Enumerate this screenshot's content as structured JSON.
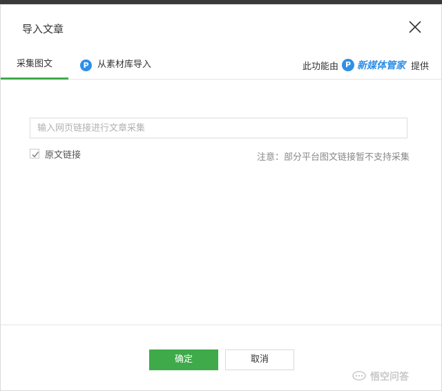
{
  "dialog": {
    "title": "导入文章"
  },
  "tabs": [
    {
      "label": "采集图文",
      "active": true
    },
    {
      "label": "从素材库导入",
      "active": false
    }
  ],
  "powered_by": {
    "prefix": "此功能由",
    "brand": "新媒体管家",
    "suffix": "提供",
    "badge": "P",
    "brand_color": "#2f8fe8"
  },
  "form": {
    "url_placeholder": "输入网页链接进行文章采集",
    "url_value": "",
    "original_link_label": "原文链接",
    "original_link_checked": true,
    "note": "注意：部分平台图文链接暂不支持采集"
  },
  "footer": {
    "ok_label": "确定",
    "cancel_label": "取消",
    "accent_color": "#3eaa49"
  },
  "watermark": {
    "text": "悟空问答"
  }
}
